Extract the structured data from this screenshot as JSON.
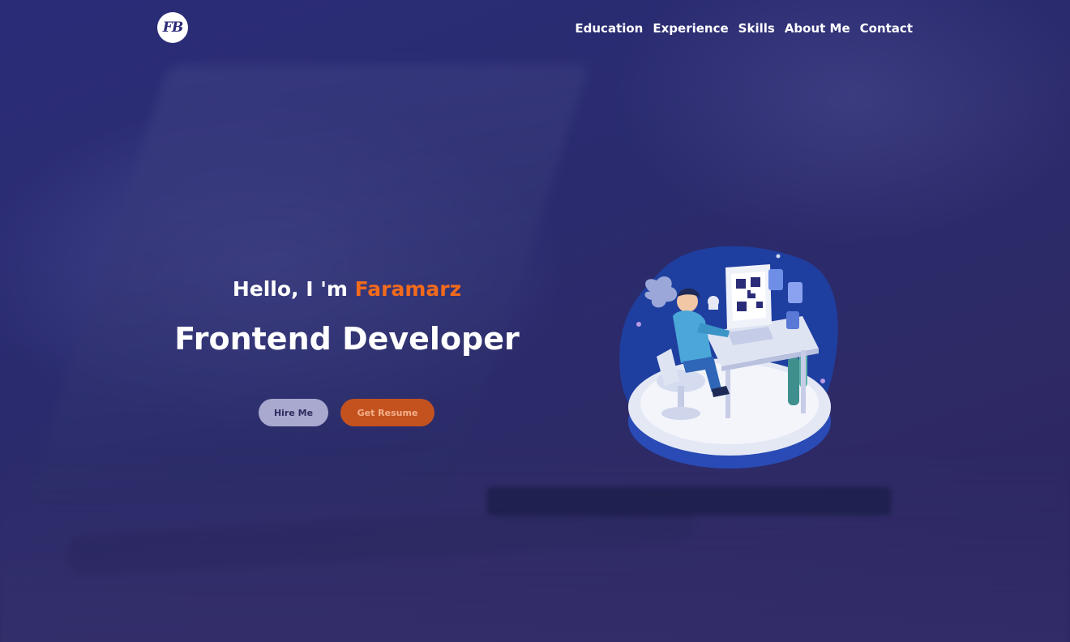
{
  "nav": {
    "logo_text": "FB",
    "links": [
      "Education",
      "Experience",
      "Skills",
      "About Me",
      "Contact"
    ]
  },
  "hero": {
    "greeting": "Hello, I 'm ",
    "name": "Faramarz",
    "role": "Frontend Developer",
    "hire_label": "Hire Me",
    "resume_label": "Get Resume"
  },
  "colors": {
    "accent": "#f26a1b",
    "background": "#2b2c78",
    "hire_button": "#a9a8cf",
    "resume_button": "#c4521f"
  },
  "icons": {
    "logo": "fb-monogram-logo",
    "illustration": "developer-at-desk-isometric"
  }
}
